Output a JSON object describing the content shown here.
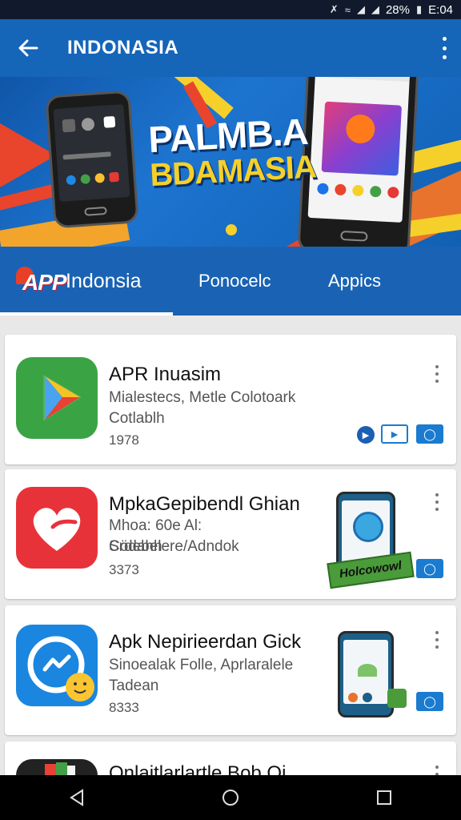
{
  "status_bar": {
    "battery": "28%",
    "time": "E:04"
  },
  "app_bar": {
    "title": "INDONASIA",
    "back_icon": "arrow-back-icon",
    "menu_icon": "more-vert-icon"
  },
  "banner": {
    "line1": "PALMB.A",
    "line2": "BDAMASIA"
  },
  "tabs": [
    {
      "label": "APP",
      "brand_suffix": "Indonsia",
      "selected": true
    },
    {
      "label": "Ponocelc",
      "selected": false
    },
    {
      "label": "Appics",
      "selected": false
    }
  ],
  "apps": [
    {
      "title": "APR Inuasim",
      "subtitle1": "Mialestecs, Metle Colotoark",
      "subtitle2": "Cotlablh",
      "count": "1978",
      "icon": "play-store-icon",
      "icon_color": "#3aa344"
    },
    {
      "title": "MpkaGepibendl Ghian",
      "subtitle1": "Mhoa: 60e Al: Srdebelere/Adndok",
      "subtitle2": "Cödahh",
      "count": "3373",
      "icon": "heart-icon",
      "icon_color": "#e8323a",
      "ribbon_text": "Holcowowl"
    },
    {
      "title": "Apk Nepirieerdan Gick",
      "subtitle1": "Sinoealak Folle, Aprlaralele",
      "subtitle2": "Tadean",
      "count": "8333",
      "icon": "messenger-icon",
      "icon_color": "#1a86e0"
    },
    {
      "title": "Qnlaitlarlartle Bob Qi",
      "icon": "photos-app-icon",
      "icon_color": "#222222"
    }
  ],
  "nav": {
    "back": "nav-back-icon",
    "home": "nav-home-icon",
    "recents": "nav-recents-icon"
  }
}
